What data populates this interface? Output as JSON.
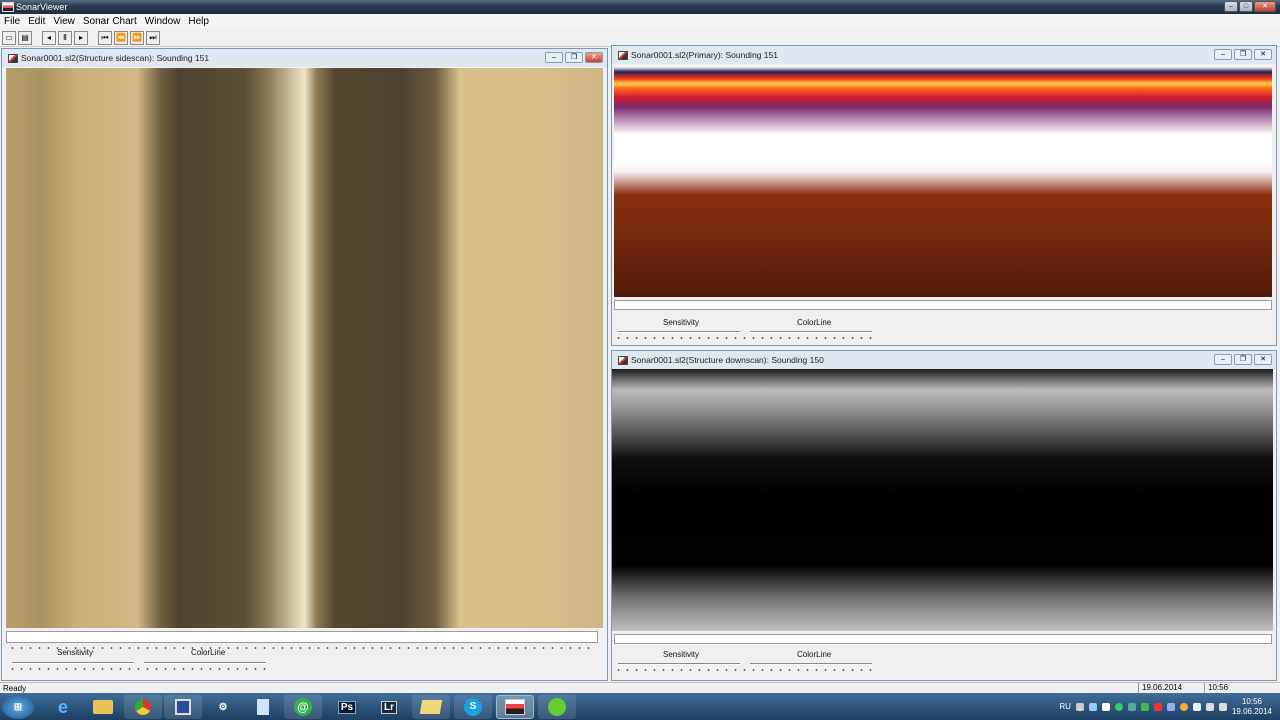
{
  "app": {
    "title": "SonarViewer"
  },
  "menu": [
    "File",
    "Edit",
    "View",
    "Sonar Chart",
    "Window",
    "Help"
  ],
  "toolbar": {
    "buttons": [
      "open",
      "print",
      "prev",
      "pause",
      "play",
      "first",
      "rewind",
      "forward",
      "last"
    ]
  },
  "windows": {
    "sidescan": {
      "title": "Sonar0001.sl2(Structure sidescan): Sounding 151",
      "sensitivity": "Sensitivity",
      "colorline": "ColorLine"
    },
    "primary": {
      "title": "Sonar0001.sl2(Primary): Sounding 151",
      "sensitivity": "Sensitivity",
      "colorline": "ColorLine"
    },
    "downscan": {
      "title": "Sonar0001.sl2(Structure downscan): Sounding 150",
      "sensitivity": "Sensitivity",
      "colorline": "ColorLine"
    }
  },
  "status": {
    "text": "Ready",
    "date": "19.06.2014",
    "time": "10:56"
  },
  "taskbar": {
    "apps": [
      "start",
      "internet-explorer",
      "explorer",
      "chrome",
      "save",
      "tool",
      "notepad",
      "mail",
      "Ps",
      "Lr",
      "folder",
      "S",
      "sonarviewer",
      "app"
    ],
    "lang": "RU",
    "clock_time": "10:56",
    "clock_date": "19.06.2014"
  }
}
